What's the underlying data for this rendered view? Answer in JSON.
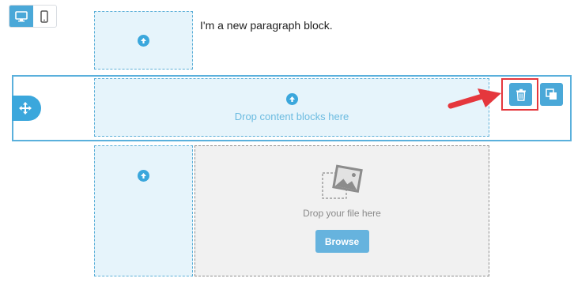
{
  "toolbar": {
    "device_modes": [
      {
        "icon": "desktop-icon",
        "active": true
      },
      {
        "icon": "mobile-icon",
        "active": false
      }
    ]
  },
  "blocks": {
    "paragraph_text": "I'm a new paragraph block.",
    "drop_content_label": "Drop content blocks here",
    "image_drop_label": "Drop your file here",
    "browse_label": "Browse"
  },
  "row_actions": {
    "icons": [
      "move-icon",
      "trash-icon",
      "copy-icon"
    ]
  },
  "annotation": {
    "arrow_color": "#e5373d",
    "highlight_color": "#e5373d"
  },
  "colors": {
    "accent": "#4aa8d8",
    "drop_zone_bg": "#e6f4fb",
    "image_zone_bg": "#f1f1f1"
  }
}
